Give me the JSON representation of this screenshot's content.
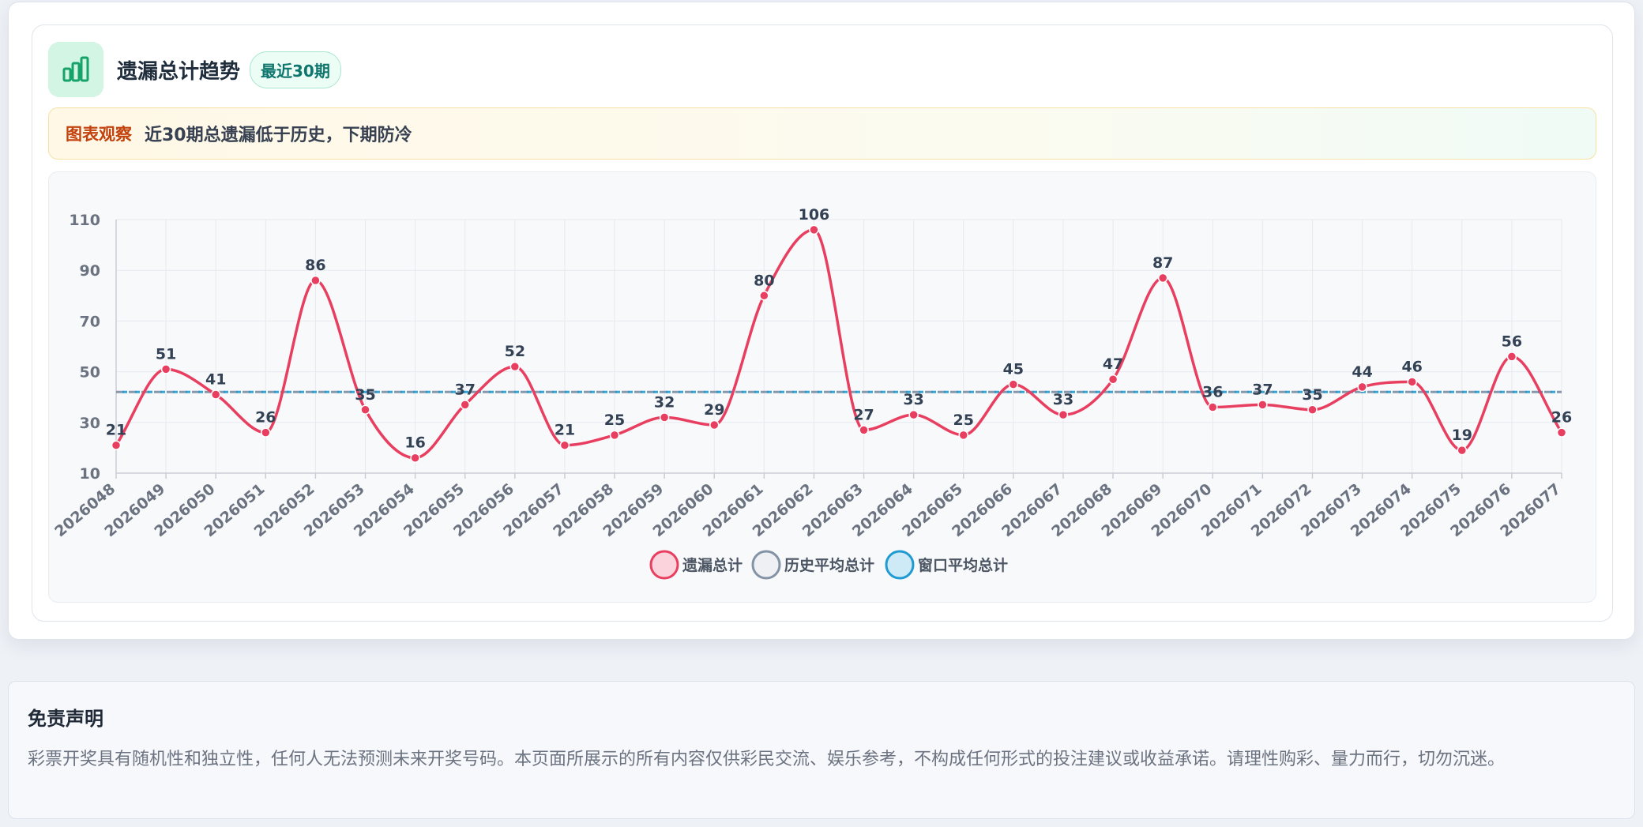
{
  "header": {
    "title": "遗漏总计趋势",
    "badge": "最近30期",
    "icon": "bar-chart-icon"
  },
  "observation": {
    "label": "图表观察",
    "text": "近30期总遗漏低于历史，下期防冷"
  },
  "disclaimer": {
    "title": "免责声明",
    "text": "彩票开奖具有随机性和独立性，任何人无法预测未来开奖号码。本页面所展示的所有内容仅供彩民交流、娱乐参考，不构成任何形式的投注建议或收益承诺。请理性购彩、量力而行，切勿沉迷。"
  },
  "colors": {
    "series_line": "#e83e5f",
    "history_avg": "#7b8ca3",
    "window_avg": "#1f9bd1",
    "accent_green": "#16a36a"
  },
  "chart_data": {
    "type": "line",
    "categories": [
      "2026048",
      "2026049",
      "2026050",
      "2026051",
      "2026052",
      "2026053",
      "2026054",
      "2026055",
      "2026056",
      "2026057",
      "2026058",
      "2026059",
      "2026060",
      "2026061",
      "2026062",
      "2026063",
      "2026064",
      "2026065",
      "2026066",
      "2026067",
      "2026068",
      "2026069",
      "2026070",
      "2026071",
      "2026072",
      "2026073",
      "2026074",
      "2026075",
      "2026076",
      "2026077"
    ],
    "series": [
      {
        "name": "遗漏总计",
        "values": [
          21,
          51,
          41,
          26,
          86,
          35,
          16,
          37,
          52,
          21,
          25,
          32,
          29,
          80,
          106,
          27,
          33,
          25,
          45,
          33,
          47,
          87,
          36,
          37,
          35,
          44,
          46,
          19,
          56,
          26
        ],
        "smooth": true,
        "data_labels": true
      },
      {
        "name": "历史平均总计",
        "values": [
          42,
          42,
          42,
          42,
          42,
          42,
          42,
          42,
          42,
          42,
          42,
          42,
          42,
          42,
          42,
          42,
          42,
          42,
          42,
          42,
          42,
          42,
          42,
          42,
          42,
          42,
          42,
          42,
          42,
          42
        ],
        "dashed": true
      },
      {
        "name": "窗口平均总计",
        "values": [
          42,
          42,
          42,
          42,
          42,
          42,
          42,
          42,
          42,
          42,
          42,
          42,
          42,
          42,
          42,
          42,
          42,
          42,
          42,
          42,
          42,
          42,
          42,
          42,
          42,
          42,
          42,
          42,
          42,
          42
        ],
        "dashed": true
      }
    ],
    "yticks": [
      10,
      30,
      50,
      70,
      90,
      110
    ],
    "ylim": [
      10,
      110
    ],
    "grid": true,
    "legend_position": "bottom-center"
  }
}
